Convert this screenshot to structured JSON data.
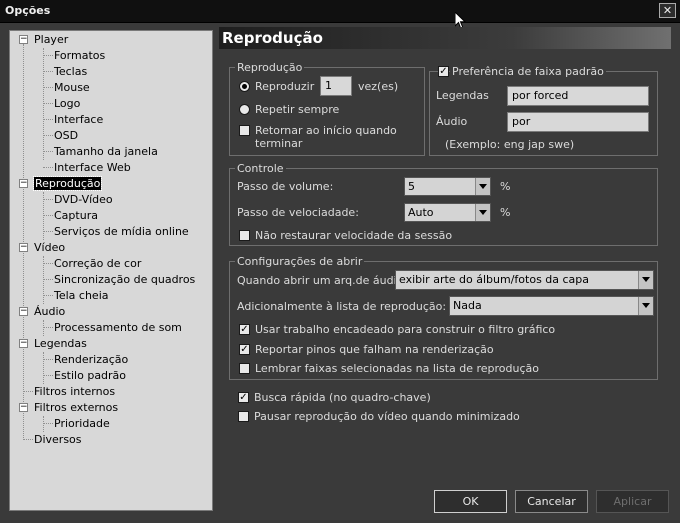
{
  "window": {
    "title": "Opções",
    "close_label": "✕"
  },
  "tree": {
    "player": "Player",
    "formatos": "Formatos",
    "teclas": "Teclas",
    "mouse": "Mouse",
    "logo": "Logo",
    "interface": "Interface",
    "osd": "OSD",
    "tamanho": "Tamanho da janela",
    "web": "Interface Web",
    "reproducao": "Reprodução",
    "dvd": "DVD-Vídeo",
    "captura": "Captura",
    "servicos": "Serviços de mídia online",
    "video": "Vídeo",
    "correcao": "Correção de cor",
    "sincronizacao": "Sincronização de quadros",
    "tela": "Tela cheia",
    "audio": "Áudio",
    "processamento": "Processamento de som",
    "legendas": "Legendas",
    "renderizacao": "Renderização",
    "estilo": "Estilo padrão",
    "filtros_internos": "Filtros internos",
    "filtros_externos": "Filtros externos",
    "prioridade": "Prioridade",
    "diversos": "Diversos",
    "expand_symbol": "−"
  },
  "header": {
    "title": "Reprodução"
  },
  "playback_group": {
    "title": "Reprodução",
    "play_label": "Reproduzir",
    "play_count": "1",
    "times_label": "vez(es)",
    "repeat_label": "Repetir sempre",
    "rewind_label": "Retornar ao início quando terminar",
    "rewind_checked": false
  },
  "track_group": {
    "title": "Preferência de faixa padrão",
    "checked": true,
    "subtitles_label": "Legendas",
    "subtitles_value": "por forced",
    "audio_label": "Áudio",
    "audio_value": "por",
    "example": "(Exemplo: eng jap swe)"
  },
  "control_group": {
    "title": "Controle",
    "volume_label": "Passo de volume:",
    "volume_value": "5",
    "volume_unit": "%",
    "speed_label": "Passo de velociadade:",
    "speed_value": "Auto",
    "speed_unit": "%",
    "no_restore_label": "Não restaurar velocidade da sessão",
    "no_restore_checked": false
  },
  "open_group": {
    "title": "Configurações de abrir",
    "audio_open_label": "Quando abrir um arq.de áudio,",
    "audio_open_value": "exibir arte do álbum/fotos da capa",
    "playlist_label": "Adicionalmente à lista de reprodução:",
    "playlist_value": "Nada",
    "threaded_label": "Usar trabalho encadeado para construir o filtro gráfico",
    "threaded_checked": true,
    "report_label": "Reportar pinos que falham na renderização",
    "report_checked": true,
    "remember_label": "Lembrar faixas selecionadas na lista de reprodução",
    "remember_checked": false
  },
  "misc": {
    "fast_seek_label": "Busca rápida (no quadro-chave)",
    "fast_seek_checked": true,
    "pause_label": "Pausar reprodução do vídeo quando minimizado",
    "pause_checked": false,
    "check_mark": "✓"
  },
  "buttons": {
    "ok": "OK",
    "cancel": "Cancelar",
    "apply": "Aplicar"
  }
}
